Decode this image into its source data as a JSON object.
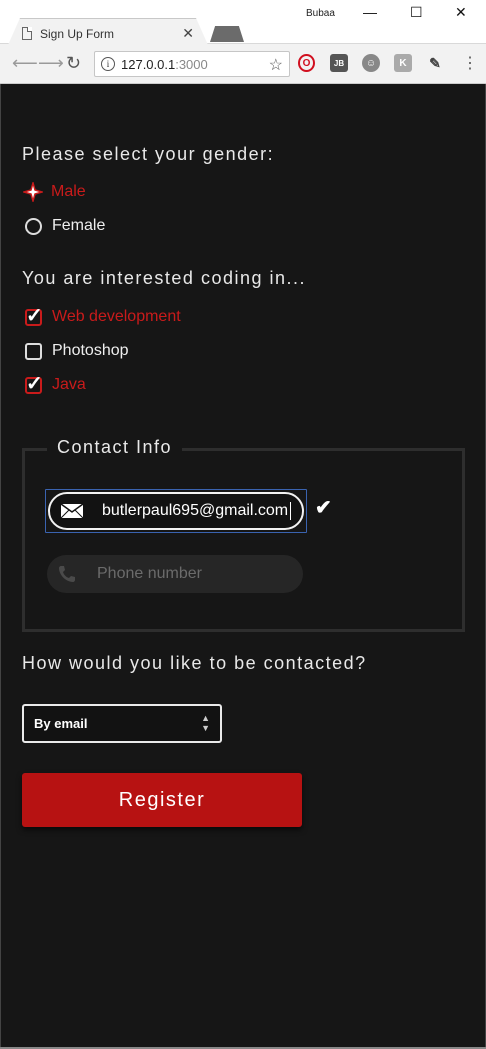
{
  "browser": {
    "tab_title": "Sign Up Form",
    "tab_close": "✕",
    "profile_name": "Bubaa",
    "window_controls": {
      "minimize": "—",
      "maximize": "☐",
      "close": "✕"
    },
    "address": {
      "host": "127.0.0.1",
      "port": ":3000"
    },
    "extensions": [
      "opera-icon",
      "jb-icon",
      "smiley-icon",
      "k-icon",
      "eyedropper-icon"
    ],
    "extension_labels": {
      "jb": "JB",
      "k": "K"
    }
  },
  "form": {
    "gender": {
      "question": "Please select your gender:",
      "options": [
        {
          "label": "Male",
          "selected": true
        },
        {
          "label": "Female",
          "selected": false
        }
      ]
    },
    "interests": {
      "question": "You are interested coding in...",
      "options": [
        {
          "label": "Web development",
          "checked": true
        },
        {
          "label": "Photoshop",
          "checked": false
        },
        {
          "label": "Java",
          "checked": true
        }
      ]
    },
    "contact": {
      "legend": "Contact Info",
      "email_value": "butlerpaul695@gmail.com",
      "phone_placeholder": "Phone number"
    },
    "contact_method": {
      "question": "How would you like to be contacted?",
      "selected": "By email"
    },
    "register_label": "Register"
  },
  "colors": {
    "accent": "#c91b1b",
    "button": "#b71212",
    "background": "#161616",
    "focus_border": "#3a63b0"
  }
}
